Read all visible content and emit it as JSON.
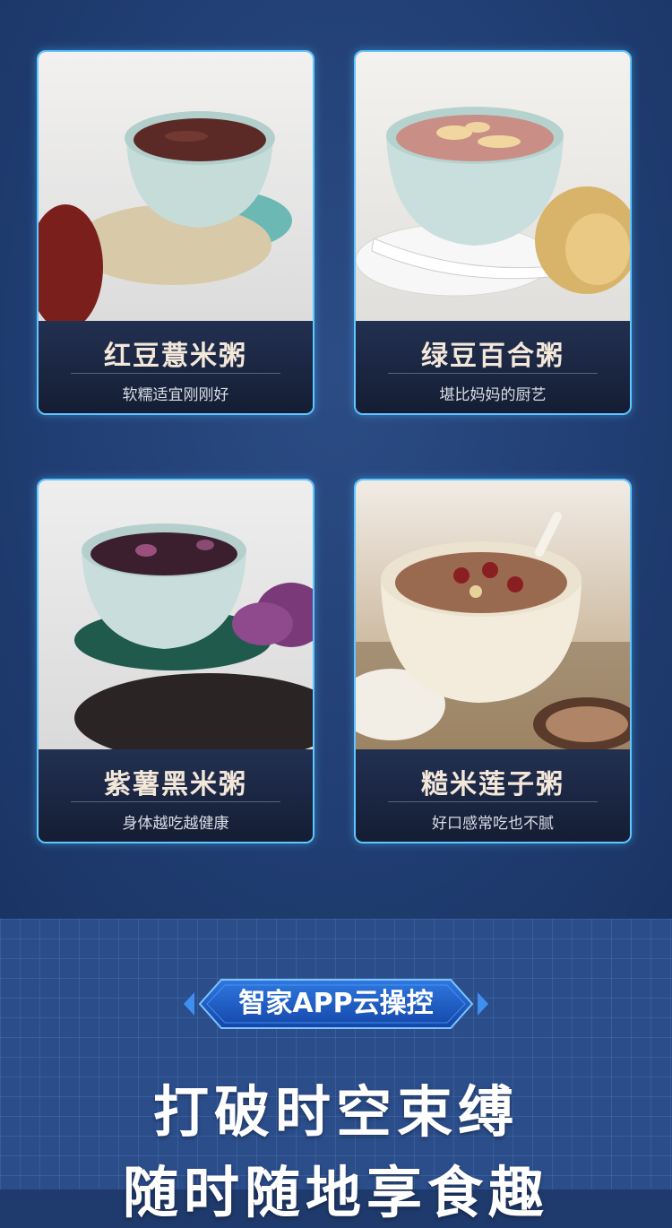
{
  "products": [
    {
      "name": "红豆薏米粥",
      "subtitle": "软糯适宜刚刚好"
    },
    {
      "name": "绿豆百合粥",
      "subtitle": "堪比妈妈的厨艺"
    },
    {
      "name": "紫薯黑米粥",
      "subtitle": "身体越吃越健康"
    },
    {
      "name": "糙米莲子粥",
      "subtitle": "好口感常吃也不腻"
    }
  ],
  "feature": {
    "badge": "智家APP云操控",
    "headline_line1": "打破时空束缚",
    "headline_line2": "随时随地享食趣"
  },
  "colors": {
    "background": "#213f74",
    "card_border": "#5fc6ff",
    "caption_bg": "#1a2540",
    "title_text": "#f3e7d9"
  }
}
